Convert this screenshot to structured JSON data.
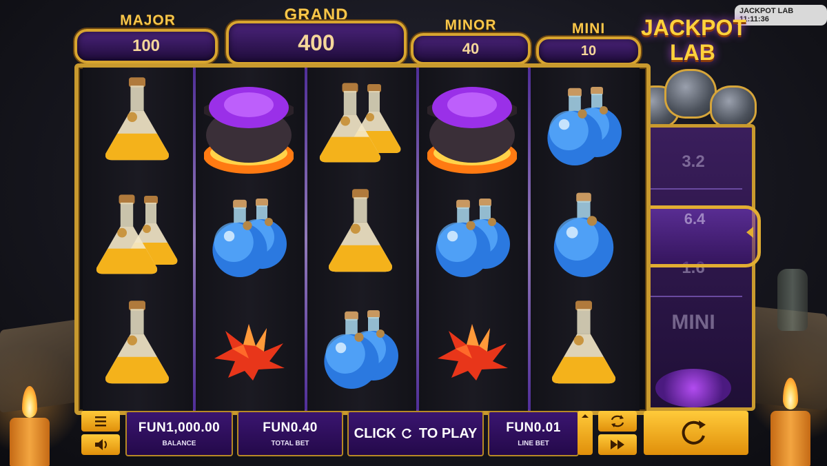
{
  "jackpots": {
    "major": {
      "label": "MAJOR",
      "value": "100"
    },
    "grand": {
      "label": "GRAND",
      "value": "400"
    },
    "minor": {
      "label": "MINOR",
      "value": "40"
    },
    "mini": {
      "label": "MINI",
      "value": "10"
    }
  },
  "logo": {
    "line1": "JACKPOT",
    "line2": "LAB"
  },
  "clock": "JACKPOT LAB 11:11:36",
  "meter": {
    "values": [
      "3.2",
      "6.4",
      "1.6",
      "MINI"
    ],
    "selected": "6.4"
  },
  "reels": [
    [
      "yellow-flask",
      "yellow-double-flask",
      "yellow-flask"
    ],
    [
      "cauldron",
      "blue-double-potion",
      "red-crystal"
    ],
    [
      "yellow-double-flask",
      "yellow-flask",
      "blue-double-potion"
    ],
    [
      "cauldron",
      "blue-double-potion",
      "red-crystal"
    ],
    [
      "blue-double-potion",
      "blue-potion",
      "yellow-flask"
    ]
  ],
  "bottom": {
    "balance": {
      "value": "FUN1,000.00",
      "label": "BALANCE"
    },
    "total_bet": {
      "value": "FUN0.40",
      "label": "TOTAL BET"
    },
    "play": {
      "before": "CLICK",
      "after": "TO PLAY"
    },
    "line_bet": {
      "value": "FUN0.01",
      "label": "LINE BET"
    }
  },
  "colors": {
    "gold": "#c99a2e",
    "purple": "#3a1570",
    "yellow_button": "#ffca3a"
  }
}
